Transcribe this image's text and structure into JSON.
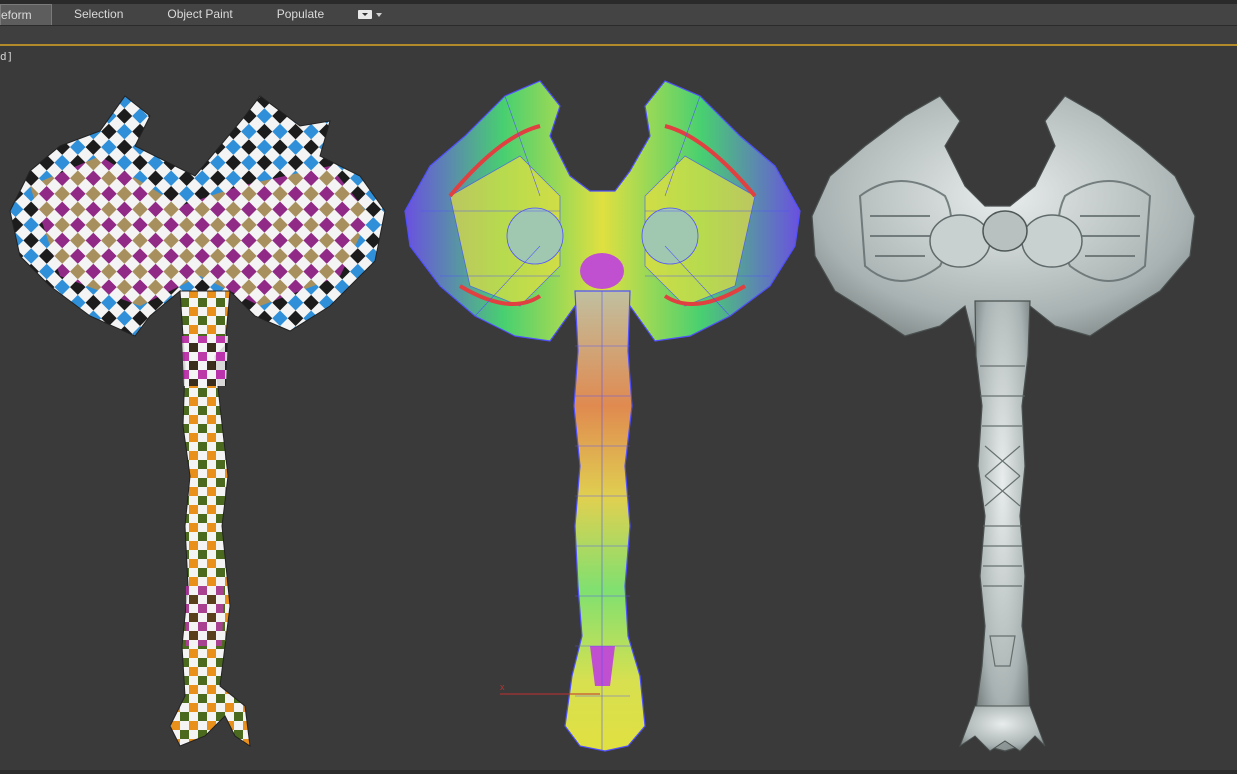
{
  "ribbon": {
    "tabs": [
      {
        "label": "eform",
        "active": true
      },
      {
        "label": "Selection",
        "active": false
      },
      {
        "label": "Object Paint",
        "active": false
      },
      {
        "label": "Populate",
        "active": false
      }
    ]
  },
  "viewport": {
    "label": "d]",
    "axis_label": "x",
    "border_color": "#b38a2a",
    "background": "#3a3a3a"
  },
  "icons": [
    "ribbon-options-dropdown-icon"
  ]
}
